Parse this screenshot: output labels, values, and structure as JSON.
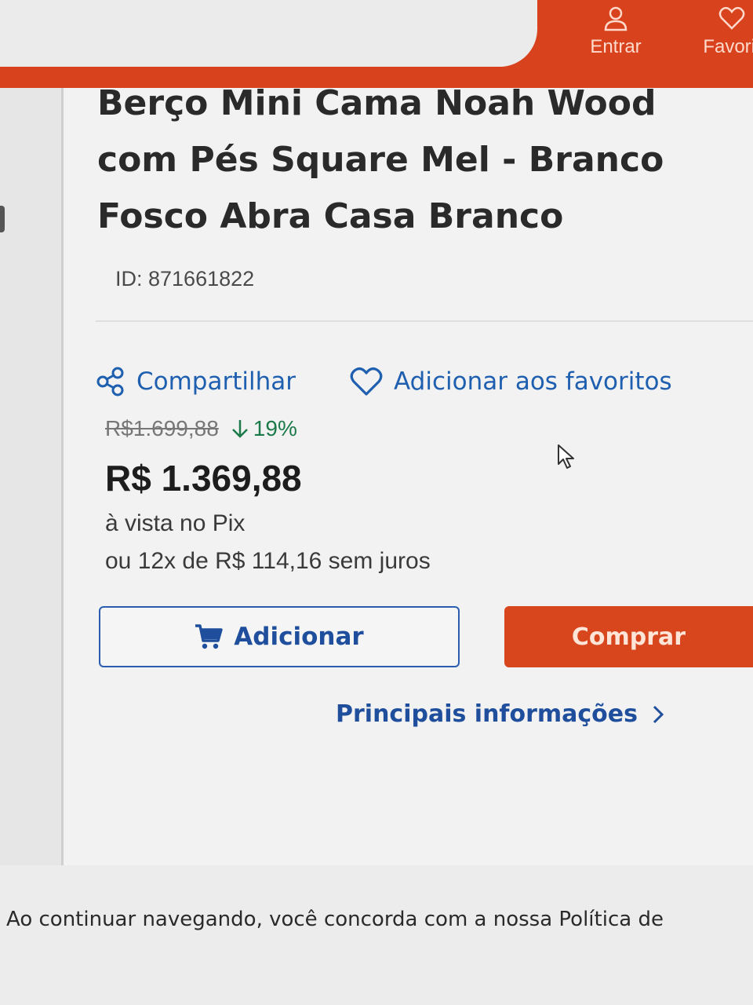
{
  "header": {
    "login_label": "Entrar",
    "favorites_label": "Favorit",
    "icons": {
      "login": "user-icon",
      "favorites": "heart-icon"
    },
    "colors": {
      "brand": "#d8421c"
    }
  },
  "product": {
    "title_lines": [
      "Berço Mini Cama Noah Wood",
      "com Pés Square Mel - Branco",
      "Fosco Abra Casa Branco"
    ],
    "id_text": "ID: 871661822"
  },
  "actions": {
    "share_label": "Compartilhar",
    "favorite_label": "Adicionar aos favoritos",
    "icons": {
      "share": "share-icon",
      "favorite": "heart-outline-icon"
    }
  },
  "pricing": {
    "old_price": "R$1.699,88",
    "discount": "19%",
    "price": "R$ 1.369,88",
    "pix_note": "à vista no Pix",
    "installments": "ou 12x de R$ 114,16 sem juros"
  },
  "buttons": {
    "add_label": "Adicionar",
    "buy_label": "Comprar",
    "icons": {
      "add": "cart-icon"
    },
    "colors": {
      "buy": "#d8461e",
      "add_border": "#2a5db0"
    }
  },
  "info_link": {
    "label": "Principais informações",
    "icon": "chevron-right-icon"
  },
  "footer": {
    "notice": "Ao continuar navegando, você concorda com a nossa Política de"
  }
}
